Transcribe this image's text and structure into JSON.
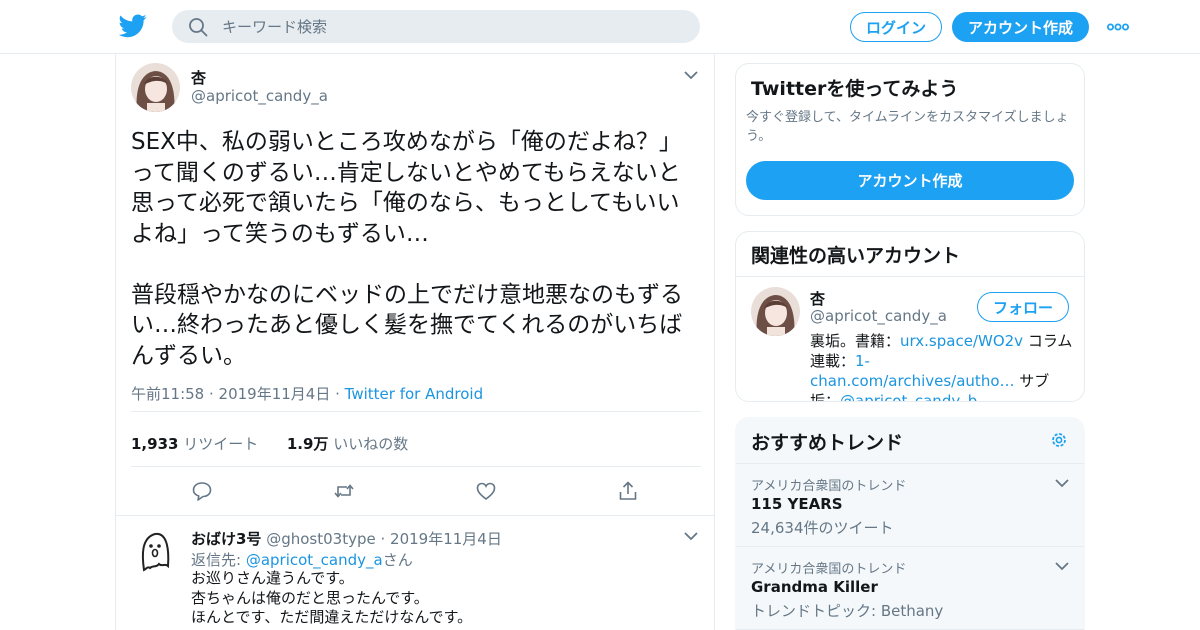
{
  "header": {
    "search_placeholder": "キーワード検索",
    "login_label": "ログイン",
    "signup_label": "アカウント作成"
  },
  "tweet": {
    "author_name": "杏",
    "author_handle": "@apricot_candy_a",
    "text": "SEX中、私の弱いところ攻めながら「俺のだよね？」って聞くのずるい…肯定しないとやめてもらえないと思って必死で頷いたら「俺のなら、もっとしてもいいよね」って笑うのもずるい…\n\n普段穏やかなのにベッドの上でだけ意地悪なのもずるい…終わったあと優しく髪を撫でてくれるのがいちばんずるい。",
    "timestamp": "午前11:58 · 2019年11月4日",
    "separator": " · ",
    "source": "Twitter for Android",
    "retweets_count": "1,933",
    "retweets_label": "リツイート",
    "likes_count": "1.9万",
    "likes_label": "いいねの数"
  },
  "reply": {
    "author_name": "おばけ3号",
    "author_handle": "@ghost03type",
    "date": "· 2019年11月4日",
    "reply_to_prefix": "返信先: ",
    "reply_to_mention": "@apricot_candy_a",
    "reply_to_suffix": "さん",
    "text": "お巡りさん違うんです。\n杏ちゃんは俺のだと思ったんです。\nほんとです、ただ間違えただけなんです。"
  },
  "sidebar": {
    "try_title": "Twitterを使ってみよう",
    "try_desc": "今すぐ登録して、タイムラインをカスタマイズしましょう。",
    "try_button": "アカウント作成",
    "related_title": "関連性の高いアカウント",
    "related_name": "杏",
    "related_handle": "@apricot_candy_a",
    "follow_label": "フォロー",
    "bio_1": "裏垢。書籍：",
    "bio_link1": "urx.space/WO2v",
    "bio_2": " コラム連載：",
    "bio_link2": "1-chan.com/archives/autho…",
    "bio_3": " サブ垢：",
    "bio_link3": "@apricot_candy_b",
    "trends_title": "おすすめトレンド",
    "trends": [
      {
        "label": "アメリカ合衆国のトレンド",
        "title": "115 YEARS",
        "sub": "24,634件のツイート"
      },
      {
        "label": "アメリカ合衆国のトレンド",
        "title": "Grandma Killer",
        "sub": "トレンドトピック: Bethany"
      }
    ]
  },
  "colors": {
    "accent": "#1da1f2",
    "link": "#1b95e0",
    "muted": "#657786",
    "border": "#e6ecf0"
  }
}
